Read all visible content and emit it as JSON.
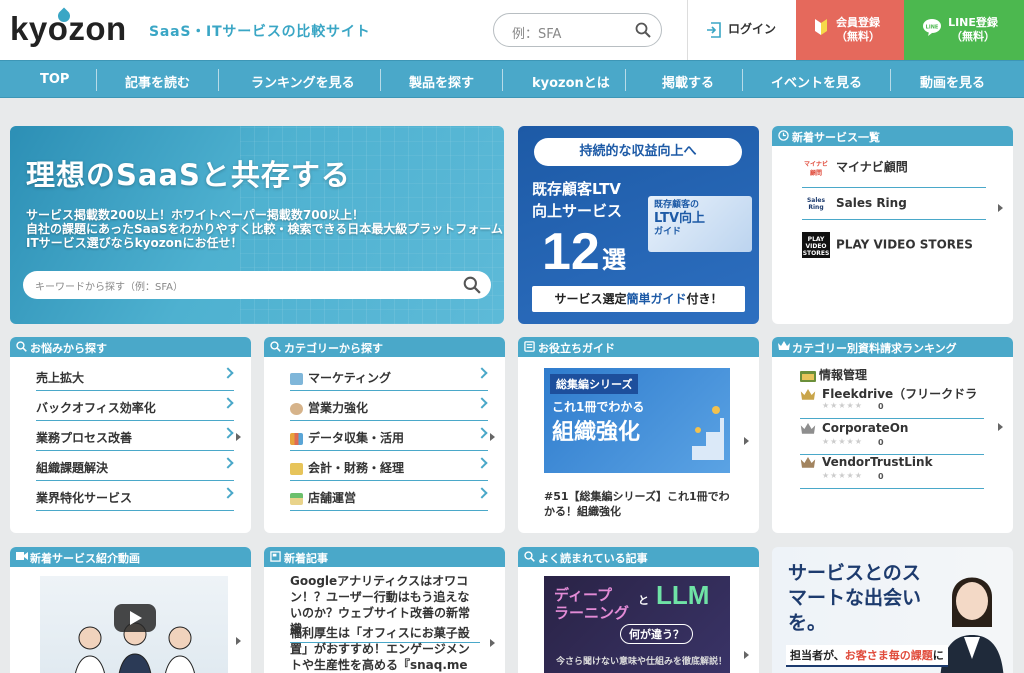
{
  "header": {
    "logo": "kyozon",
    "tagline": "SaaS・ITサービスの比較サイト",
    "search_placeholder": "例：SFA",
    "login_label": "ログイン",
    "register_line1": "会員登録",
    "register_line2": "（無料）",
    "line_line1": "LINE登録",
    "line_line2": "（無料）"
  },
  "nav": [
    "TOP",
    "記事を読む",
    "ランキングを見る",
    "製品を探す",
    "kyozonとは",
    "掲載する",
    "イベントを見る",
    "動画を見る"
  ],
  "hero": {
    "title": "理想のSaaSと共存する",
    "line1": "サービス掲載数200以上！ホワイトペーパー掲載数700以上！",
    "line2": "自社の課題にあったSaaSをわかりやすく比較・検索できる日本最大級プラットフォーム",
    "line3": "ITサービス選びならkyozonにお任せ！",
    "search_placeholder": "キーワードから探す（例：SFA）"
  },
  "ltv": {
    "top": "持続的な収益向上へ",
    "line1": "既存顧客LTV",
    "line2": "向上サービス",
    "num": "12",
    "sen": "選",
    "book_line1": "既存顧客の",
    "book_line2": "LTV向上",
    "book_line3": "ガイド",
    "bottom_pre": "サービス選定",
    "bottom_em": "簡単ガイド",
    "bottom_post": "付き！"
  },
  "new_services": {
    "title": "新着サービス一覧",
    "items": [
      {
        "logo": "マイナビ顧問",
        "name": "マイナビ顧問"
      },
      {
        "logo": "Sales Ring",
        "name": "Sales Ring"
      },
      {
        "logo": "PLAY VIDEO STORES",
        "name": "PLAY VIDEO STORES"
      }
    ]
  },
  "troubles": {
    "title": "お悩みから探す",
    "items": [
      "売上拡大",
      "バックオフィス効率化",
      "業務プロセス改善",
      "組織課題解決",
      "業界特化サービス"
    ]
  },
  "categories": {
    "title": "カテゴリーから探す",
    "items": [
      "マーケティング",
      "営業力強化",
      "データ収集・活用",
      "会計・財務・経理",
      "店舗運営"
    ]
  },
  "guide": {
    "title": "お役立ちガイド",
    "img_series": "総集編シリーズ",
    "img_line1": "これ1冊でわかる",
    "img_line2": "組織強化",
    "caption": "#51【総集編シリーズ】これ1冊でわかる！組織強化"
  },
  "ranking": {
    "title": "カテゴリー別資料請求ランキング",
    "category": "情報管理",
    "items": [
      {
        "name": "Fleekdrive（フリークドラ",
        "count": "0"
      },
      {
        "name": "CorporateOn",
        "count": "0"
      },
      {
        "name": "VendorTrustLink",
        "count": "0"
      }
    ],
    "stars": "★★★★★"
  },
  "video": {
    "title": "新着サービス紹介動画"
  },
  "news": {
    "title": "新着記事",
    "items": [
      "Googleアナリティクスはオワコン！？ユーザー行動はもう追えないのか？ウェブサイト改善の新常識",
      "福利厚生は「オフィスにお菓子設置」がおすすめ！エンゲージメントや生産性を高める『snaq.me"
    ]
  },
  "popular": {
    "title": "よく読まれている記事",
    "img_line1": "ディープ",
    "img_line2": "ラーニング",
    "img_and": "と",
    "img_llm": "LLM",
    "img_sub": "何が違う？",
    "img_foot": "今さら聞けない意味や仕組みを徹底解説！"
  },
  "promo": {
    "headline": "サービスとのスマートな出会いを。",
    "foot_pre": "担当者が、",
    "foot_em": "お客さま毎の課題",
    "foot_post": "に"
  }
}
